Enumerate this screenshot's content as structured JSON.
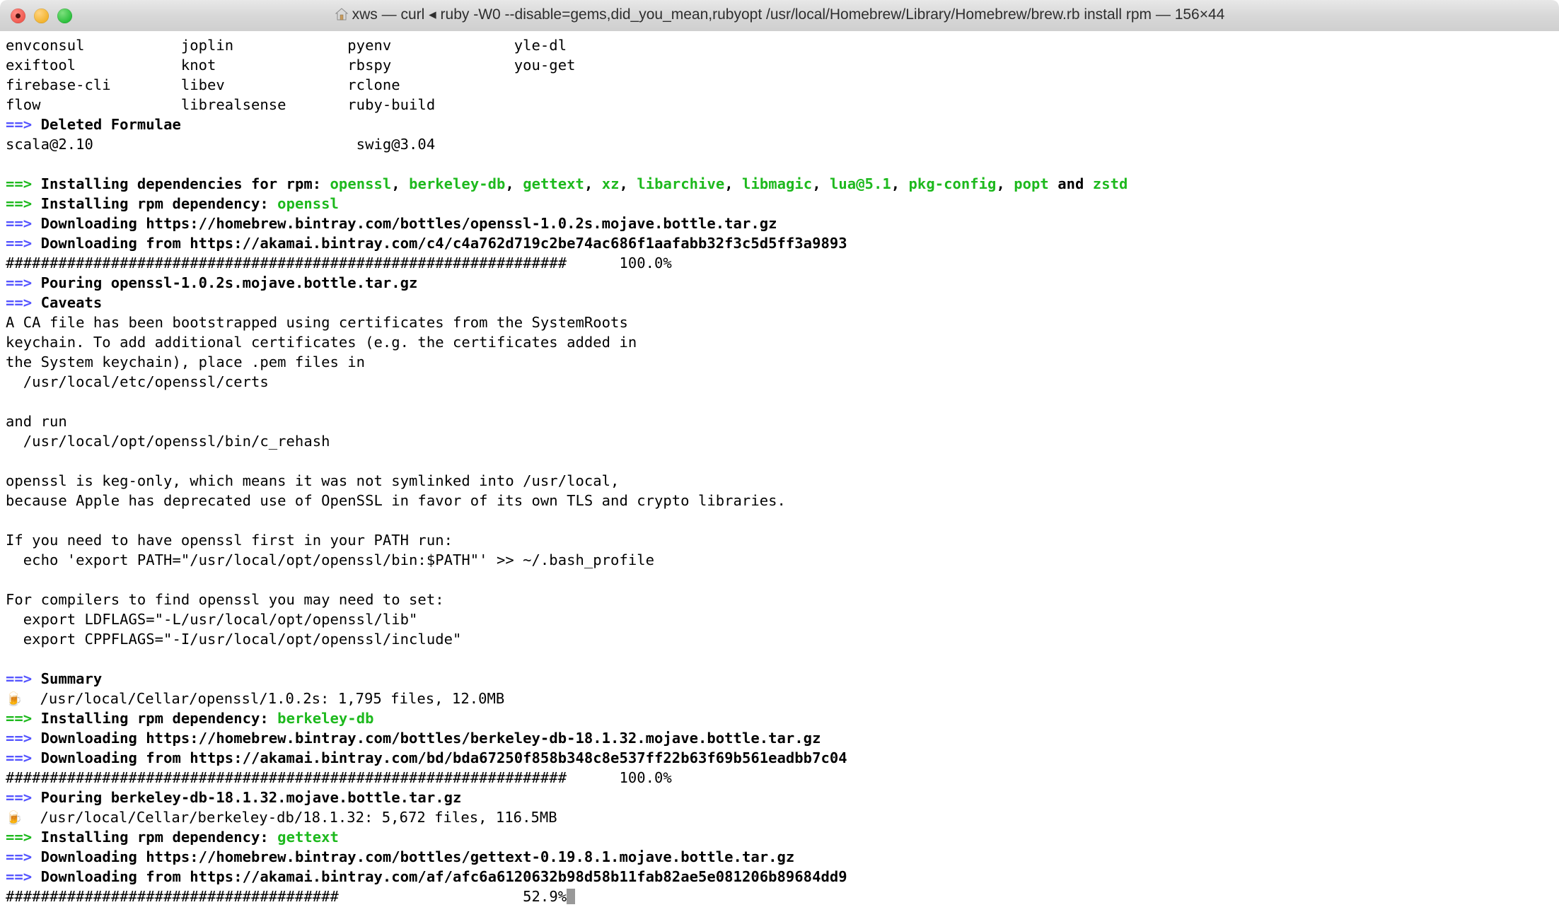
{
  "window": {
    "title": "xws — curl ◂ ruby -W0 --disable=gems,did_you_mean,rubyopt /usr/local/Homebrew/Library/Homebrew/brew.rb install rpm — 156×44",
    "home_icon": "home-icon",
    "controls": {
      "close": "close-button",
      "minimize": "minimize-button",
      "zoom": "zoom-button"
    },
    "size_label": "156×44"
  },
  "colors": {
    "background": "#ffffff",
    "foreground": "#000000",
    "blue_arrow": "#5555ff",
    "green": "#1db91d",
    "cursor": "#999999",
    "titlebar": "#d8d8d8"
  },
  "terminal": {
    "columns": 156,
    "rows": 44,
    "formula_columns": {
      "col1": [
        "envconsul",
        "exiftool",
        "firebase-cli",
        "flow"
      ],
      "col2": [
        "joplin",
        "knot",
        "libev",
        "librealsense"
      ],
      "col3": [
        "pyenv",
        "rbspy",
        "rclone",
        "ruby-build"
      ],
      "col4": [
        "yle-dl",
        "you-get"
      ]
    },
    "deleted_formulae_header": "Deleted Formulae",
    "deleted_formulae": [
      "scala@2.10",
      "swig@3.04"
    ],
    "install_deps": {
      "prefix": "Installing dependencies for rpm: ",
      "deps": [
        "openssl",
        "berkeley-db",
        "gettext",
        "xz",
        "libarchive",
        "libmagic",
        "lua@5.1",
        "pkg-config",
        "popt"
      ],
      "conjunction": " and ",
      "last": "zstd"
    },
    "lines": [
      {
        "type": "cols",
        "a": "envconsul",
        "b": "joplin",
        "c": "pyenv",
        "d": "yle-dl"
      },
      {
        "type": "cols",
        "a": "exiftool",
        "b": "knot",
        "c": "rbspy",
        "d": "you-get"
      },
      {
        "type": "cols",
        "a": "firebase-cli",
        "b": "libev",
        "c": "rclone",
        "d": ""
      },
      {
        "type": "cols",
        "a": "flow",
        "b": "librealsense",
        "c": "ruby-build",
        "d": ""
      },
      {
        "type": "arrow",
        "text": "Deleted Formulae"
      },
      {
        "type": "two",
        "a": "scala@2.10",
        "b": "swig@3.04"
      },
      {
        "type": "blank"
      },
      {
        "type": "deps"
      },
      {
        "type": "arrowg-dep",
        "label": "Installing rpm dependency: ",
        "name": "openssl"
      },
      {
        "type": "arrow",
        "text": "Downloading https://homebrew.bintray.com/bottles/openssl-1.0.2s.mojave.bottle.tar.gz"
      },
      {
        "type": "arrow",
        "text": "Downloading from https://akamai.bintray.com/c4/c4a762d719c2be74ac686f1aafabb32f3c5d5ff3a9893"
      },
      {
        "type": "progress",
        "hashes": 64,
        "pct": "100.0%"
      },
      {
        "type": "arrow",
        "text": "Pouring openssl-1.0.2s.mojave.bottle.tar.gz"
      },
      {
        "type": "arrow",
        "text": "Caveats"
      },
      {
        "type": "plain",
        "text": "A CA file has been bootstrapped using certificates from the SystemRoots"
      },
      {
        "type": "plain",
        "text": "keychain. To add additional certificates (e.g. the certificates added in"
      },
      {
        "type": "plain",
        "text": "the System keychain), place .pem files in"
      },
      {
        "type": "plain",
        "text": "  /usr/local/etc/openssl/certs"
      },
      {
        "type": "blank"
      },
      {
        "type": "plain",
        "text": "and run"
      },
      {
        "type": "plain",
        "text": "  /usr/local/opt/openssl/bin/c_rehash"
      },
      {
        "type": "blank"
      },
      {
        "type": "plain",
        "text": "openssl is keg-only, which means it was not symlinked into /usr/local,"
      },
      {
        "type": "plain",
        "text": "because Apple has deprecated use of OpenSSL in favor of its own TLS and crypto libraries."
      },
      {
        "type": "blank"
      },
      {
        "type": "plain",
        "text": "If you need to have openssl first in your PATH run:"
      },
      {
        "type": "plain",
        "text": "  echo 'export PATH=\"/usr/local/opt/openssl/bin:$PATH\"' >> ~/.bash_profile"
      },
      {
        "type": "blank"
      },
      {
        "type": "plain",
        "text": "For compilers to find openssl you may need to set:"
      },
      {
        "type": "plain",
        "text": "  export LDFLAGS=\"-L/usr/local/opt/openssl/lib\""
      },
      {
        "type": "plain",
        "text": "  export CPPFLAGS=\"-I/usr/local/opt/openssl/include\""
      },
      {
        "type": "blank"
      },
      {
        "type": "arrow",
        "text": "Summary"
      },
      {
        "type": "beer",
        "text": "/usr/local/Cellar/openssl/1.0.2s: 1,795 files, 12.0MB"
      },
      {
        "type": "arrowg-dep",
        "label": "Installing rpm dependency: ",
        "name": "berkeley-db"
      },
      {
        "type": "arrow",
        "text": "Downloading https://homebrew.bintray.com/bottles/berkeley-db-18.1.32.mojave.bottle.tar.gz"
      },
      {
        "type": "arrow",
        "text": "Downloading from https://akamai.bintray.com/bd/bda67250f858b348c8e537ff22b63f69b561eadbb7c04"
      },
      {
        "type": "progress",
        "hashes": 64,
        "pct": "100.0%"
      },
      {
        "type": "arrow",
        "text": "Pouring berkeley-db-18.1.32.mojave.bottle.tar.gz"
      },
      {
        "type": "beer",
        "text": "/usr/local/Cellar/berkeley-db/18.1.32: 5,672 files, 116.5MB"
      },
      {
        "type": "arrowg-dep",
        "label": "Installing rpm dependency: ",
        "name": "gettext"
      },
      {
        "type": "arrow",
        "text": "Downloading https://homebrew.bintray.com/bottles/gettext-0.19.8.1.mojave.bottle.tar.gz"
      },
      {
        "type": "arrow",
        "text": "Downloading from https://akamai.bintray.com/af/afc6a6120632b98d58b11fab82ae5e081206b89684dd9"
      },
      {
        "type": "progress-cursor",
        "hashes": 38,
        "pct": "52.9%"
      }
    ]
  }
}
